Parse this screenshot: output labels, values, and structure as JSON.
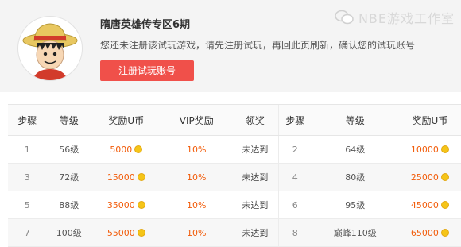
{
  "header": {
    "title": "隋唐英雄传专区6期",
    "notice": "您还未注册该试玩游戏，请先注册试玩，再回此页刷新，确认您的试玩账号",
    "register_button": "注册试玩账号",
    "watermark": "NBE游戏工作室"
  },
  "table": {
    "columns_left": [
      "步骤",
      "等级",
      "奖励U币",
      "VIP奖励",
      "领奖"
    ],
    "columns_right": [
      "步骤",
      "等级",
      "奖励U币"
    ],
    "rows": [
      {
        "step": "1",
        "level": "56级",
        "coins": "5000",
        "vip": "10%",
        "status": "未达到",
        "step2": "2",
        "level2": "64级",
        "coins2": "10000"
      },
      {
        "step": "3",
        "level": "72级",
        "coins": "15000",
        "vip": "10%",
        "status": "未达到",
        "step2": "4",
        "level2": "80级",
        "coins2": "25000"
      },
      {
        "step": "5",
        "level": "88级",
        "coins": "35000",
        "vip": "10%",
        "status": "未达到",
        "step2": "6",
        "level2": "95级",
        "coins2": "45000"
      },
      {
        "step": "7",
        "level": "100级",
        "coins": "55000",
        "vip": "10%",
        "status": "未达到",
        "step2": "8",
        "level2": "巅峰110级",
        "coins2": "65000"
      }
    ]
  },
  "colors": {
    "accent_red": "#f0504a",
    "coin_orange": "#f25c0a",
    "coin_icon": "#f5c518"
  },
  "icons": {
    "avatar": "luffy-avatar",
    "coin": "coin-icon",
    "watermark": "wechat-icon"
  }
}
